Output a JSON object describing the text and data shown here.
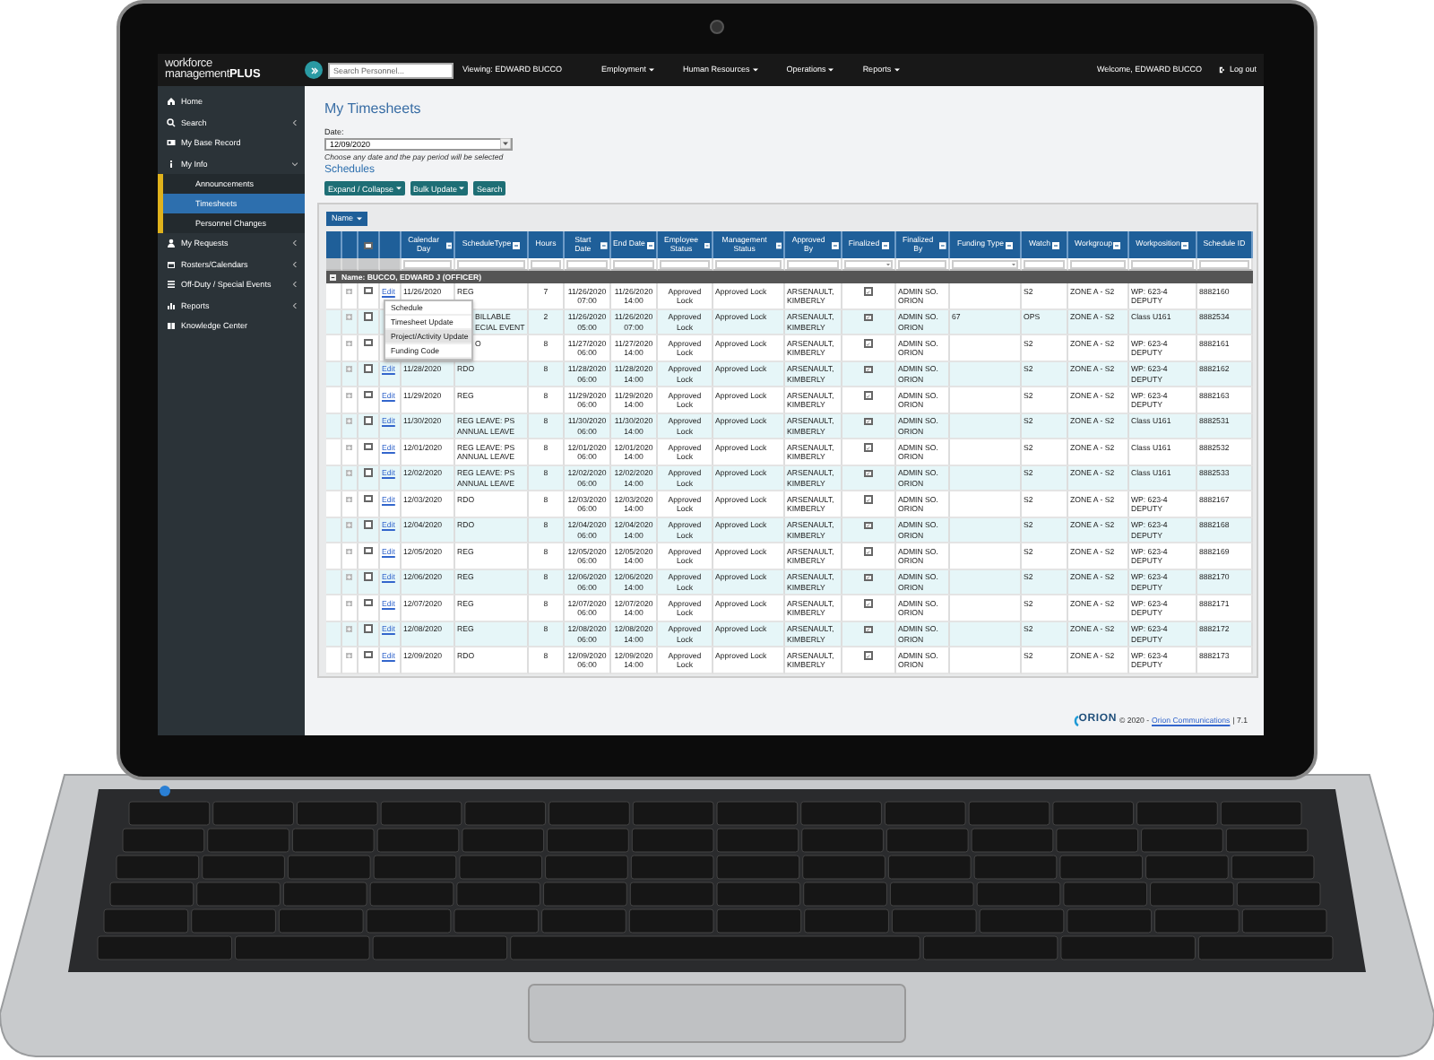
{
  "navbar": {
    "logo": {
      "line1": "workforce",
      "line2": "management",
      "suffix": "PLUS"
    },
    "search": {
      "placeholder": "Search Personnel..."
    },
    "viewing": "Viewing: EDWARD BUCCO",
    "menus": [
      "Employment",
      "Human Resources",
      "Operations",
      "Reports"
    ],
    "welcome": "Welcome, EDWARD BUCCO",
    "logout": "Log out"
  },
  "sidebar": {
    "items": [
      {
        "label": "Home",
        "selected": false
      },
      {
        "label": "Search",
        "selected": false,
        "expanded": false
      },
      {
        "label": "My Base Record",
        "selected": false
      },
      {
        "label": "My Info",
        "selected": false,
        "expanded": true,
        "children": [
          {
            "label": "Announcements",
            "selected": false
          },
          {
            "label": "Timesheets",
            "selected": true
          },
          {
            "label": "Personnel Changes",
            "selected": false
          }
        ]
      },
      {
        "label": "My Requests",
        "selected": false,
        "expanded": false
      },
      {
        "label": "Rosters/Calendars",
        "selected": false,
        "expanded": false
      },
      {
        "label": "Off-Duty / Special Events",
        "selected": false,
        "expanded": false
      },
      {
        "label": "Reports",
        "selected": false,
        "expanded": false
      },
      {
        "label": "Knowledge Center",
        "selected": false
      }
    ]
  },
  "page": {
    "title": "My Timesheets",
    "date_label": "Date:",
    "date_value": "12/09/2020",
    "date_hint": "Choose any date and the pay period will be selected",
    "section": "Schedules",
    "buttons": [
      {
        "label": "Expand / Collapse",
        "dropdown": true
      },
      {
        "label": "Bulk Update",
        "dropdown": true
      },
      {
        "label": "Search",
        "dropdown": false
      }
    ]
  },
  "table": {
    "group_button": "Name",
    "columns": [
      {
        "label": "Calendar Day",
        "filter": true,
        "filter_dropdown": false
      },
      {
        "label": "ScheduleType",
        "filter": true,
        "filter_dropdown": false
      },
      {
        "label": "Hours",
        "filter": false,
        "filter_dropdown": false
      },
      {
        "label": "Start Date",
        "filter": true,
        "filter_dropdown": false
      },
      {
        "label": "End Date",
        "filter": true,
        "filter_dropdown": false
      },
      {
        "label": "Employee Status",
        "filter": true,
        "filter_dropdown": false
      },
      {
        "label": "Management Status",
        "filter": true,
        "filter_dropdown": false
      },
      {
        "label": "Approved By",
        "filter": true,
        "filter_dropdown": false
      },
      {
        "label": "Finalized",
        "filter": true,
        "filter_dropdown": true
      },
      {
        "label": "Finalized By",
        "filter": true,
        "filter_dropdown": false
      },
      {
        "label": "Funding Type",
        "filter": true,
        "filter_dropdown": true
      },
      {
        "label": "Watch",
        "filter": true,
        "filter_dropdown": false
      },
      {
        "label": "Workgroup",
        "filter": true,
        "filter_dropdown": false
      },
      {
        "label": "Workposition",
        "filter": true,
        "filter_dropdown": false
      },
      {
        "label": "Schedule ID",
        "filter": false,
        "filter_dropdown": false
      }
    ],
    "header_checked": false,
    "group": "Name: BUCCO, EDWARD J (OFFICER)",
    "rows": [
      {
        "edit": "Edit",
        "checked": false,
        "cells": [
          "11/26/2020",
          "REG",
          "7",
          "11/26/2020 07:00",
          "11/26/2020 14:00",
          "Approved Lock",
          "Approved Lock",
          "ARSENAULT, KIMBERLY",
          "",
          "ADMIN SO. ORION",
          "",
          "S2",
          "ZONE A - S2",
          "WP: 623-4 DEPUTY",
          "8882160"
        ],
        "finalized": true
      },
      {
        "checked": false,
        "cells": [
          "",
          "BILLABLE ECIAL EVENT",
          "2",
          "11/26/2020 05:00",
          "11/26/2020 07:00",
          "Approved Lock",
          "Approved Lock",
          "ARSENAULT, KIMBERLY",
          "",
          "ADMIN SO. ORION",
          "67",
          "OPS",
          "ZONE A - S2",
          "Class U161",
          "8882534"
        ],
        "finalized": true
      },
      {
        "checked": false,
        "cells": [
          "",
          "O",
          "8",
          "11/27/2020 06:00",
          "11/27/2020 14:00",
          "Approved Lock",
          "Approved Lock",
          "ARSENAULT, KIMBERLY",
          "",
          "ADMIN SO. ORION",
          "",
          "S2",
          "ZONE A - S2",
          "WP: 623-4 DEPUTY",
          "8882161"
        ],
        "finalized": true
      },
      {
        "edit": "Edit",
        "checked": false,
        "cells": [
          "11/28/2020",
          "RDO",
          "8",
          "11/28/2020 06:00",
          "11/28/2020 14:00",
          "Approved Lock",
          "Approved Lock",
          "ARSENAULT, KIMBERLY",
          "",
          "ADMIN SO. ORION",
          "",
          "S2",
          "ZONE A - S2",
          "WP: 623-4 DEPUTY",
          "8882162"
        ],
        "finalized": true
      },
      {
        "edit": "Edit",
        "checked": false,
        "cells": [
          "11/29/2020",
          "REG",
          "8",
          "11/29/2020 06:00",
          "11/29/2020 14:00",
          "Approved Lock",
          "Approved Lock",
          "ARSENAULT, KIMBERLY",
          "",
          "ADMIN SO. ORION",
          "",
          "S2",
          "ZONE A - S2",
          "WP: 623-4 DEPUTY",
          "8882163"
        ],
        "finalized": true
      },
      {
        "edit": "Edit",
        "checked": false,
        "cells": [
          "11/30/2020",
          "REG LEAVE: PS ANNUAL LEAVE",
          "8",
          "11/30/2020 06:00",
          "11/30/2020 14:00",
          "Approved Lock",
          "Approved Lock",
          "ARSENAULT, KIMBERLY",
          "",
          "ADMIN SO. ORION",
          "",
          "S2",
          "ZONE A - S2",
          "Class U161",
          "8882531"
        ],
        "finalized": true
      },
      {
        "edit": "Edit",
        "checked": false,
        "cells": [
          "12/01/2020",
          "REG LEAVE: PS ANNUAL LEAVE",
          "8",
          "12/01/2020 06:00",
          "12/01/2020 14:00",
          "Approved Lock",
          "Approved Lock",
          "ARSENAULT, KIMBERLY",
          "",
          "ADMIN SO. ORION",
          "",
          "S2",
          "ZONE A - S2",
          "Class U161",
          "8882532"
        ],
        "finalized": true
      },
      {
        "edit": "Edit",
        "checked": false,
        "cells": [
          "12/02/2020",
          "REG LEAVE: PS ANNUAL LEAVE",
          "8",
          "12/02/2020 06:00",
          "12/02/2020 14:00",
          "Approved Lock",
          "Approved Lock",
          "ARSENAULT, KIMBERLY",
          "",
          "ADMIN SO. ORION",
          "",
          "S2",
          "ZONE A - S2",
          "Class U161",
          "8882533"
        ],
        "finalized": true
      },
      {
        "edit": "Edit",
        "checked": false,
        "cells": [
          "12/03/2020",
          "RDO",
          "8",
          "12/03/2020 06:00",
          "12/03/2020 14:00",
          "Approved Lock",
          "Approved Lock",
          "ARSENAULT, KIMBERLY",
          "",
          "ADMIN SO. ORION",
          "",
          "S2",
          "ZONE A - S2",
          "WP: 623-4 DEPUTY",
          "8882167"
        ],
        "finalized": true
      },
      {
        "edit": "Edit",
        "checked": false,
        "cells": [
          "12/04/2020",
          "RDO",
          "8",
          "12/04/2020 06:00",
          "12/04/2020 14:00",
          "Approved Lock",
          "Approved Lock",
          "ARSENAULT, KIMBERLY",
          "",
          "ADMIN SO. ORION",
          "",
          "S2",
          "ZONE A - S2",
          "WP: 623-4 DEPUTY",
          "8882168"
        ],
        "finalized": true
      },
      {
        "edit": "Edit",
        "checked": false,
        "cells": [
          "12/05/2020",
          "REG",
          "8",
          "12/05/2020 06:00",
          "12/05/2020 14:00",
          "Approved Lock",
          "Approved Lock",
          "ARSENAULT, KIMBERLY",
          "",
          "ADMIN SO. ORION",
          "",
          "S2",
          "ZONE A - S2",
          "WP: 623-4 DEPUTY",
          "8882169"
        ],
        "finalized": true
      },
      {
        "edit": "Edit",
        "checked": false,
        "cells": [
          "12/06/2020",
          "REG",
          "8",
          "12/06/2020 06:00",
          "12/06/2020 14:00",
          "Approved Lock",
          "Approved Lock",
          "ARSENAULT, KIMBERLY",
          "",
          "ADMIN SO. ORION",
          "",
          "S2",
          "ZONE A - S2",
          "WP: 623-4 DEPUTY",
          "8882170"
        ],
        "finalized": true
      },
      {
        "edit": "Edit",
        "checked": false,
        "cells": [
          "12/07/2020",
          "REG",
          "8",
          "12/07/2020 06:00",
          "12/07/2020 14:00",
          "Approved Lock",
          "Approved Lock",
          "ARSENAULT, KIMBERLY",
          "",
          "ADMIN SO. ORION",
          "",
          "S2",
          "ZONE A - S2",
          "WP: 623-4 DEPUTY",
          "8882171"
        ],
        "finalized": true
      },
      {
        "edit": "Edit",
        "checked": false,
        "cells": [
          "12/08/2020",
          "REG",
          "8",
          "12/08/2020 06:00",
          "12/08/2020 14:00",
          "Approved Lock",
          "Approved Lock",
          "ARSENAULT, KIMBERLY",
          "",
          "ADMIN SO. ORION",
          "",
          "S2",
          "ZONE A - S2",
          "WP: 623-4 DEPUTY",
          "8882172"
        ],
        "finalized": true
      },
      {
        "edit": "Edit",
        "checked": false,
        "cells": [
          "12/09/2020",
          "RDO",
          "8",
          "12/09/2020 06:00",
          "12/09/2020 14:00",
          "Approved Lock",
          "Approved Lock",
          "ARSENAULT, KIMBERLY",
          "",
          "ADMIN SO. ORION",
          "",
          "S2",
          "ZONE A - S2",
          "WP: 623-4 DEPUTY",
          "8882173"
        ],
        "finalized": true
      }
    ]
  },
  "edit_menu": [
    {
      "label": "Schedule",
      "selected": false
    },
    {
      "label": "Timesheet Update",
      "selected": false
    },
    {
      "label": "Project/Activity Update",
      "selected": true
    },
    {
      "label": "Funding Code",
      "selected": false
    }
  ],
  "footer": {
    "logo": "ORION",
    "copyright": "© 2020 -",
    "link": "Orion Communications",
    "version": "| 7.1"
  }
}
